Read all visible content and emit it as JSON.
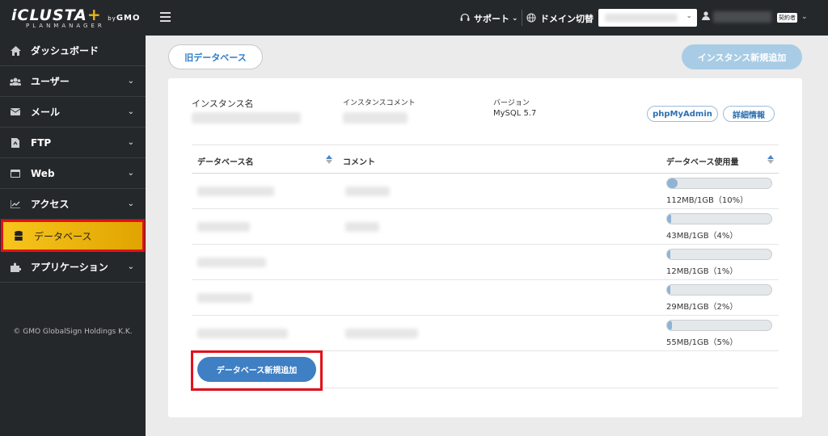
{
  "sidebar": {
    "logo": {
      "main": "iCLUSTA",
      "plus": "+",
      "by": "by",
      "gmo": "GMO",
      "sub": "PLANMANAGER"
    },
    "items": [
      {
        "label": "ダッシュボード",
        "icon": "home-icon",
        "chevron": ""
      },
      {
        "label": "ユーザー",
        "icon": "users-icon",
        "chevron": "⌄"
      },
      {
        "label": "メール",
        "icon": "mail-icon",
        "chevron": "⌄"
      },
      {
        "label": "FTP",
        "icon": "file-icon",
        "chevron": "⌄"
      },
      {
        "label": "Web",
        "icon": "window-icon",
        "chevron": "⌄"
      },
      {
        "label": "アクセス",
        "icon": "chart-icon",
        "chevron": "⌄"
      },
      {
        "label": "データベース",
        "icon": "database-icon",
        "chevron": ""
      },
      {
        "label": "アプリケーション",
        "icon": "puzzle-icon",
        "chevron": "⌄"
      }
    ],
    "copyright": "© GMO GlobalSign Holdings K.K."
  },
  "topbar": {
    "support": "サポート",
    "domain_switch": "ドメイン切替",
    "role_badge": "契約者"
  },
  "main": {
    "old_db_button": "旧データベース",
    "add_instance_button": "インスタンス新規追加",
    "instance": {
      "name_label": "インスタンス名",
      "comment_label": "インスタンスコメント",
      "version_label": "バージョン",
      "version_value": "MySQL 5.7",
      "phpmyadmin_button": "phpMyAdmin",
      "details_button": "詳細情報"
    },
    "table": {
      "headers": {
        "name": "データベース名",
        "comment": "コメント",
        "usage": "データベース使用量"
      },
      "rows": [
        {
          "usage_text": "112MB/1GB（10%）",
          "percent": 10
        },
        {
          "usage_text": "43MB/1GB（4%）",
          "percent": 4
        },
        {
          "usage_text": "12MB/1GB（1%）",
          "percent": 1
        },
        {
          "usage_text": "29MB/1GB（2%）",
          "percent": 2
        },
        {
          "usage_text": "55MB/1GB（5%）",
          "percent": 5
        }
      ]
    },
    "add_db_button": "データベース新規追加"
  },
  "colors": {
    "accent": "#f7c51c",
    "highlight": "#e3101b",
    "primary": "#3f7fc4"
  }
}
